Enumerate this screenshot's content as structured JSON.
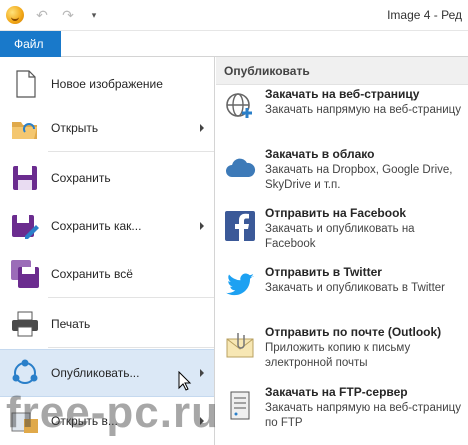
{
  "titlebar": {
    "title": "Image 4 - Ред",
    "icons": [
      "app-logo-icon",
      "undo-icon",
      "redo-icon",
      "customize-qat-icon"
    ]
  },
  "menubar": {
    "file_tab": "Файл"
  },
  "left_menu": {
    "items": [
      {
        "label": "Новое изображение",
        "icon": "new-image-icon",
        "submenu": false
      },
      {
        "label": "Открыть",
        "icon": "open-folder-icon",
        "submenu": true
      },
      {
        "label": "Сохранить",
        "icon": "save-icon",
        "submenu": false
      },
      {
        "label": "Сохранить как...",
        "icon": "save-as-icon",
        "submenu": true
      },
      {
        "label": "Сохранить всё",
        "icon": "save-all-icon",
        "submenu": false
      },
      {
        "label": "Печать",
        "icon": "print-icon",
        "submenu": false
      },
      {
        "label": "Опубликовать...",
        "icon": "share-icon",
        "submenu": true,
        "active": true
      },
      {
        "label": "Открыть в...",
        "icon": "open-in-icon",
        "submenu": true
      }
    ]
  },
  "publish_panel": {
    "header": "Опубликовать",
    "items": [
      {
        "title": "Закачать на веб-страницу",
        "desc": "Закачать напрямую на веб-страницу",
        "icon": "web-globe-icon"
      },
      {
        "title": "Закачать в облако",
        "desc": "Закачать на Dropbox, Google Drive, SkyDrive и т.п.",
        "icon": "cloud-icon"
      },
      {
        "title": "Отправить на Facebook",
        "desc": "Закачать и опубликовать на Facebook",
        "icon": "facebook-icon"
      },
      {
        "title": "Отправить в Twitter",
        "desc": "Закачать и опубликовать в Twitter",
        "icon": "twitter-icon"
      },
      {
        "title": "Отправить по почте (Outlook)",
        "desc": "Приложить копию к письму электронной почты",
        "icon": "mail-attachment-icon"
      },
      {
        "title": "Закачать на FTP-сервер",
        "desc": "Закачать напрямую на веб-страницу по FTP",
        "icon": "ftp-server-icon"
      }
    ]
  },
  "watermark": "free-pc.ru",
  "colors": {
    "accent": "#1979ca",
    "active_bg": "#dbe8f6",
    "save_purple": "#6b2c8f",
    "facebook": "#3b5998",
    "twitter": "#1da1f2",
    "cloud": "#3d7ab8"
  }
}
